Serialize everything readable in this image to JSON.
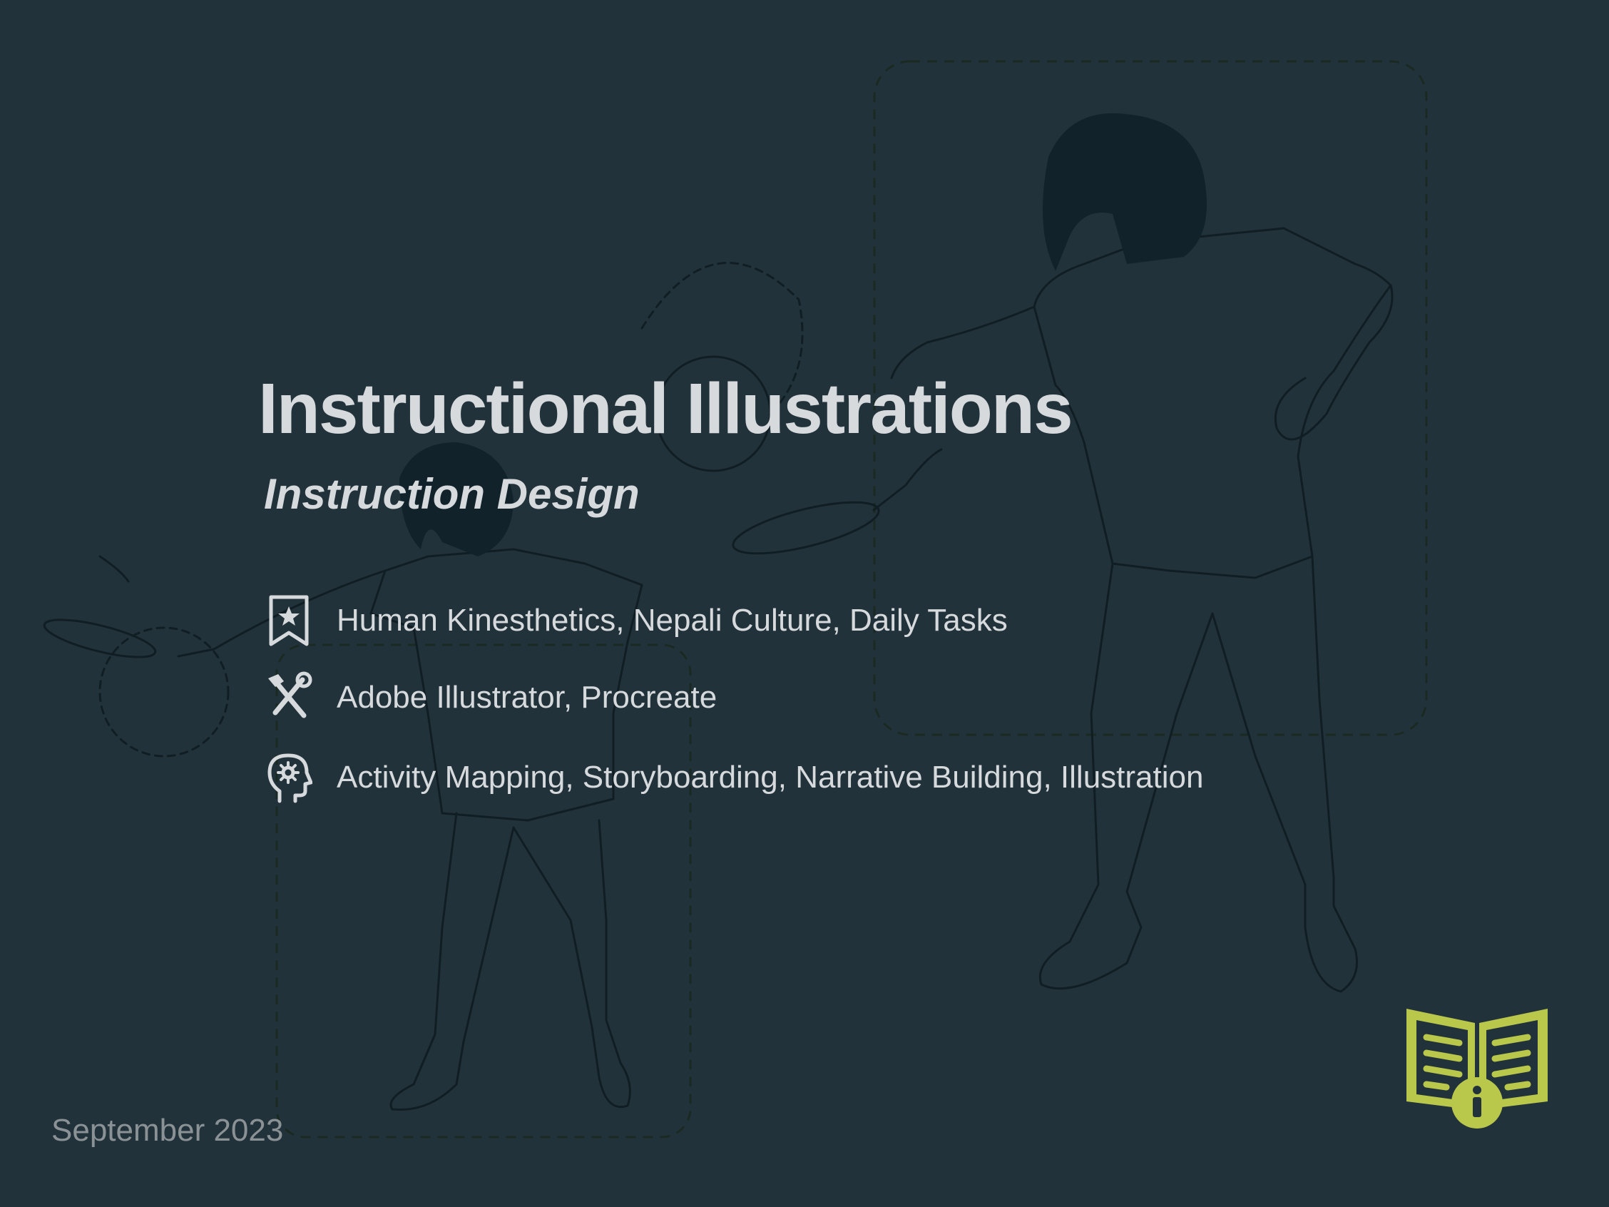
{
  "header": {
    "title": "Instructional Illustrations",
    "subtitle": "Instruction Design"
  },
  "details": [
    {
      "icon": "bookmark-star-icon",
      "text": "Human Kinesthetics, Nepali Culture, Daily Tasks"
    },
    {
      "icon": "tools-icon",
      "text": "Adobe Illustrator, Procreate"
    },
    {
      "icon": "head-gear-icon",
      "text": "Activity Mapping, Storyboarding, Narrative Building, Illustration"
    }
  ],
  "footer": {
    "date": "September 2023"
  },
  "badge": {
    "icon": "book-info-icon"
  },
  "colors": {
    "background": "#22323a",
    "text": "#d6dadd",
    "muted": "#8a9296",
    "accent": "#b9c84a",
    "line_art": "#0f1e24"
  }
}
